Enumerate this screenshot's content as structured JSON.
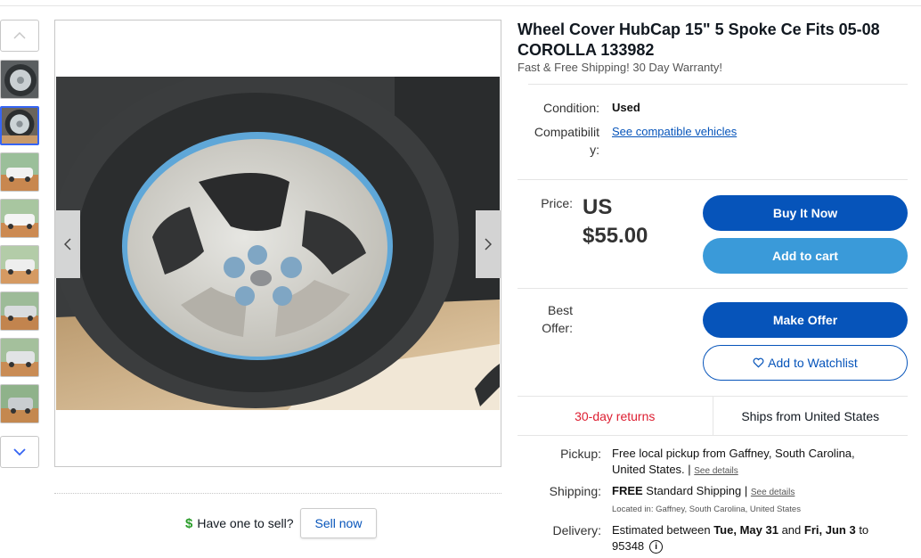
{
  "listing": {
    "title": "Wheel Cover HubCap 15\" 5 Spoke Ce Fits 05-08 COROLLA 133982",
    "subtitle": "Fast & Free Shipping! 30 Day Warranty!",
    "condition_label": "Condition:",
    "condition_value": "Used",
    "compat_label_1": "Compatibilit",
    "compat_label_2": "y:",
    "compat_link": "See compatible vehicles"
  },
  "pricing": {
    "label": "Price:",
    "currency": "US",
    "amount": "$55.00",
    "buy_now": "Buy It Now",
    "add_to_cart": "Add to cart",
    "best_offer_label_1": "Best",
    "best_offer_label_2": "Offer:",
    "make_offer": "Make Offer",
    "watchlist": "Add to Watchlist"
  },
  "shipping_summary": {
    "returns": "30-day returns",
    "ships_from": "Ships from United States"
  },
  "details": {
    "pickup_label": "Pickup:",
    "pickup_line1": "Free local pickup from Gaffney, South Carolina,",
    "pickup_line2": "United States.",
    "pickup_see": "See details",
    "shipping_label": "Shipping:",
    "shipping_free": "FREE",
    "shipping_text": "Standard Shipping",
    "shipping_see": "See details",
    "located_in": "Located in: Gaffney, South Carolina, United States",
    "delivery_label": "Delivery:",
    "delivery_pre": "Estimated between",
    "delivery_start": "Tue, May 31",
    "delivery_and": "and",
    "delivery_end": "Fri, Jun 3",
    "delivery_to": "to",
    "delivery_zip": "95348"
  },
  "sell": {
    "prompt": "Have one to sell?",
    "button": "Sell now"
  },
  "icons": {
    "thumb_up": "chevron-up-icon",
    "thumb_down": "chevron-down-icon",
    "prev": "chevron-left-icon",
    "next": "chevron-right-icon",
    "dollar": "dollar-icon",
    "heart": "heart-icon",
    "info": "info-icon"
  },
  "colors": {
    "primary": "#0654ba",
    "secondary": "#3a9ad9",
    "returns": "#dd1e31",
    "thumb_active": "#3665f3"
  }
}
